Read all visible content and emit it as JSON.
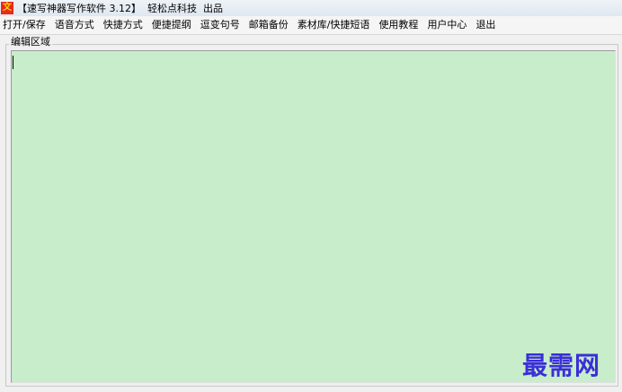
{
  "window": {
    "icon_glyph": "文",
    "title": "【速写神器写作软件 3.12】  轻松点科技  出品"
  },
  "menu": [
    {
      "label": "打开/保存"
    },
    {
      "label": "语音方式"
    },
    {
      "label": "快捷方式"
    },
    {
      "label": "便捷提纲"
    },
    {
      "label": "逗变句号"
    },
    {
      "label": "邮箱备份"
    },
    {
      "label": "素材库/快捷短语"
    },
    {
      "label": "使用教程"
    },
    {
      "label": "用户中心"
    },
    {
      "label": "退出"
    }
  ],
  "editor": {
    "group_label": "编辑区域",
    "content": "",
    "background_color": "#c8edcb"
  },
  "watermark": {
    "text": "最需网",
    "color": "#3b2fd8"
  }
}
